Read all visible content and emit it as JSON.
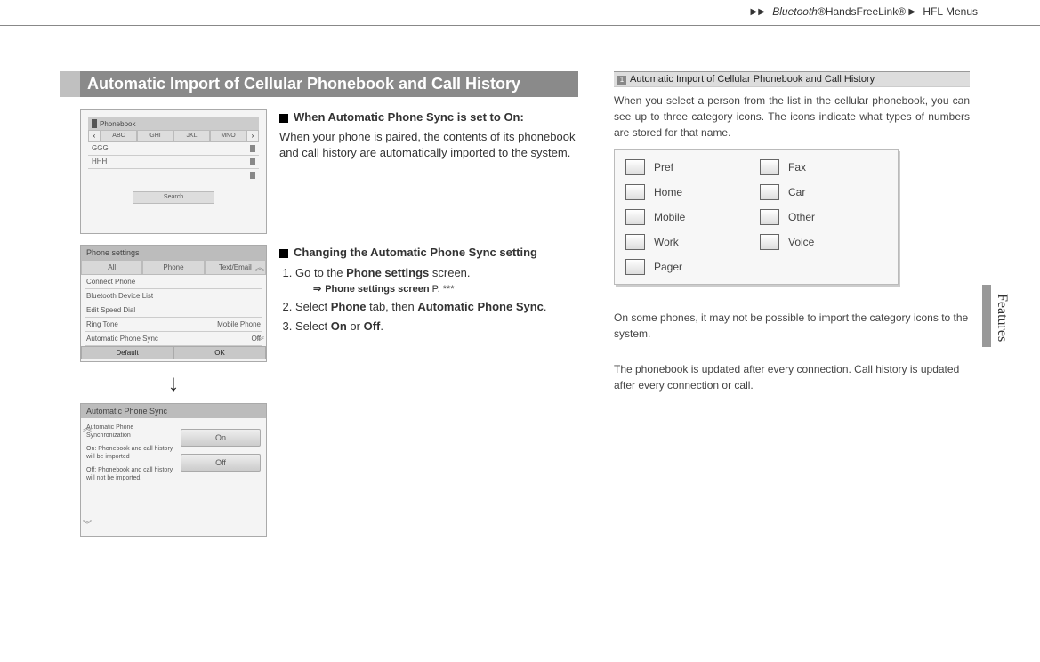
{
  "breadcrumb": {
    "arrows": "▶▶",
    "product": "Bluetooth®",
    "feature": "HandsFreeLink®",
    "arrows2": "▶",
    "section": "HFL Menus"
  },
  "side_tab": "Features",
  "section_title": "Automatic Import of Cellular Phonebook and Call History",
  "block1": {
    "heading": "When Automatic Phone Sync is set to On:",
    "body": "When your phone is paired, the contents of its phonebook and call history are automatically imported to the system."
  },
  "block2": {
    "heading": "Changing the Automatic Phone Sync setting",
    "steps": {
      "s1a": "Go to the ",
      "s1b": "Phone settings",
      "s1c": " screen.",
      "xref_label": "Phone settings screen",
      "xref_page": "P. ***",
      "s2a": "Select ",
      "s2b": "Phone",
      "s2c": " tab, then ",
      "s2d": "Automatic Phone Sync",
      "s2e": ".",
      "s3a": "Select ",
      "s3b": "On",
      "s3c": " or ",
      "s3d": "Off",
      "s3e": "."
    }
  },
  "thumb_phonebook": {
    "title": "Phonebook",
    "tabs": [
      "ABC",
      "GHI",
      "JKL",
      "MNO"
    ],
    "rows": [
      "GGG",
      "HHH",
      ""
    ],
    "search": "Search"
  },
  "thumb_settings": {
    "title": "Phone settings",
    "tabs": [
      "All",
      "Phone",
      "Text/Email"
    ],
    "items": [
      {
        "label": "Connect Phone",
        "value": ""
      },
      {
        "label": "Bluetooth Device List",
        "value": ""
      },
      {
        "label": "Edit Speed Dial",
        "value": ""
      },
      {
        "label": "Ring Tone",
        "value": "Mobile Phone"
      },
      {
        "label": "Automatic Phone Sync",
        "value": "Off"
      }
    ],
    "footer_left": "Default",
    "footer_right": "OK"
  },
  "thumb_autosync": {
    "title": "Automatic Phone Sync",
    "desc_title": "Automatic Phone Synchronization",
    "desc_on": "On: Phonebook and call history will be imported",
    "desc_off": "Off: Phonebook and call history will not be imported.",
    "btn_on": "On",
    "btn_off": "Off"
  },
  "info": {
    "header": "Automatic Import of Cellular Phonebook and Call History",
    "intro": "When you select a person from the list in the cellular phonebook, you can see up to three category icons. The icons indicate what types of numbers are stored for that name.",
    "categories": {
      "pref": "Pref",
      "home": "Home",
      "mobile": "Mobile",
      "work": "Work",
      "pager": "Pager",
      "fax": "Fax",
      "car": "Car",
      "other": "Other",
      "voice": "Voice"
    },
    "note1": "On some phones, it may not be possible to import the category icons to the system.",
    "note2": "The phonebook is updated after every connection. Call history is updated after every connection or call."
  },
  "glyph_down_arrow": "↓"
}
